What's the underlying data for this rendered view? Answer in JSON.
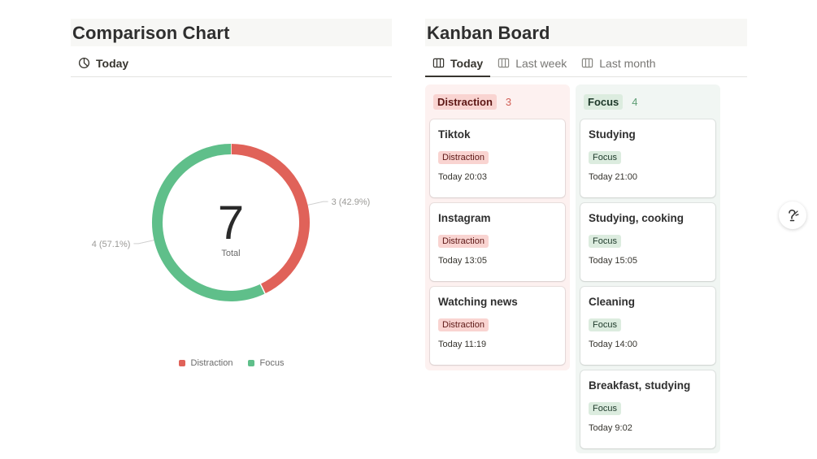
{
  "chart_panel": {
    "title": "Comparison Chart",
    "view": {
      "label": "Today",
      "icon": "pie-chart-icon"
    }
  },
  "chart_data": {
    "type": "pie",
    "categories": [
      "Distraction",
      "Focus"
    ],
    "values": [
      3,
      4
    ],
    "colors": [
      "#e06259",
      "#5fbf8a"
    ],
    "slice_labels": [
      "3 (42.9%)",
      "4 (57.1%)"
    ],
    "center_value": "7",
    "center_label": "Total",
    "legend": [
      "Distraction",
      "Focus"
    ],
    "legend_position": "bottom"
  },
  "kanban_panel": {
    "title": "Kanban Board",
    "tabs": [
      {
        "label": "Today",
        "icon": "board-icon",
        "active": true
      },
      {
        "label": "Last week",
        "icon": "board-icon",
        "active": false
      },
      {
        "label": "Last month",
        "icon": "board-icon",
        "active": false
      }
    ],
    "columns": [
      {
        "name": "Distraction",
        "count": "3",
        "bg": "#fdf1f0",
        "tag_bg": "#f9d4d1",
        "tag_color": "#5d1715",
        "count_color": "#d15e55",
        "cards": [
          {
            "title": "Tiktok",
            "tag": "Distraction",
            "date": "Today 20:03"
          },
          {
            "title": "Instagram",
            "tag": "Distraction",
            "date": "Today 13:05"
          },
          {
            "title": "Watching news",
            "tag": "Distraction",
            "date": "Today 11:19"
          }
        ]
      },
      {
        "name": "Focus",
        "count": "4",
        "bg": "#f1f6f3",
        "tag_bg": "#dcecdf",
        "tag_color": "#1c3829",
        "count_color": "#5f9e75",
        "cards": [
          {
            "title": "Studying",
            "tag": "Focus",
            "date": "Today 21:00"
          },
          {
            "title": "Studying, cooking",
            "tag": "Focus",
            "date": "Today 15:05"
          },
          {
            "title": "Cleaning",
            "tag": "Focus",
            "date": "Today 14:00"
          },
          {
            "title": "Breakfast, studying",
            "tag": "Focus",
            "date": "Today 9:02"
          }
        ]
      }
    ]
  },
  "floating_button": {
    "icon": "help-icon"
  }
}
